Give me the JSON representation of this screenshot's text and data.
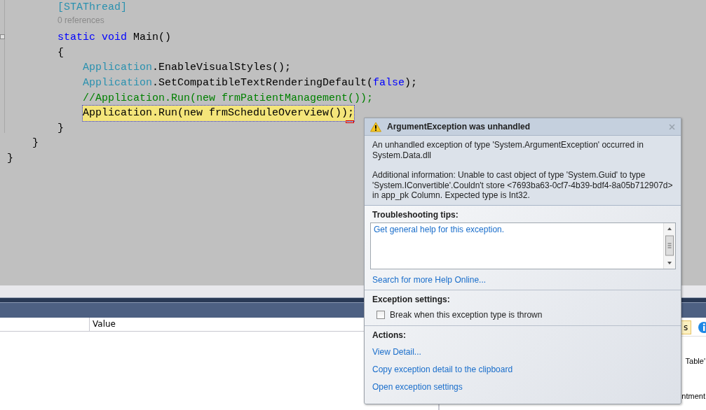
{
  "editor": {
    "lines": [
      {
        "children": [
          {
            "children": [
              {
                "kind": "code",
                "tokens": [
                  {
                    "text": "[STAThread]",
                    "kind": "type"
                  }
                ]
              },
              {
                "kind": "lens",
                "tokens": [
                  {
                    "text": "0 references",
                    "kind": "lens"
                  }
                ]
              },
              {
                "kind": "code",
                "collapsible": true,
                "tokens": [
                  {
                    "text": "static ",
                    "kind": "keyword"
                  },
                  {
                    "text": "void",
                    "kind": "keyword"
                  },
                  {
                    "text": " Main()",
                    "kind": "plain"
                  }
                ]
              },
              {
                "kind": "code",
                "tokens": [
                  {
                    "text": "{",
                    "kind": "plain"
                  }
                ],
                "children": [
                  {
                    "kind": "code",
                    "tokens": [
                      {
                        "text": "Application",
                        "kind": "type"
                      },
                      {
                        "text": ".EnableVisualStyles();",
                        "kind": "plain"
                      }
                    ]
                  },
                  {
                    "kind": "code",
                    "tokens": [
                      {
                        "text": "Application",
                        "kind": "type"
                      },
                      {
                        "text": ".SetCompatibleTextRenderingDefault(",
                        "kind": "plain"
                      },
                      {
                        "text": "false",
                        "kind": "keyword"
                      },
                      {
                        "text": ");",
                        "kind": "plain"
                      }
                    ]
                  },
                  {
                    "kind": "code",
                    "tokens": [
                      {
                        "text": "//Application.Run(new frmPatientManagement());",
                        "kind": "comment"
                      }
                    ]
                  },
                  {
                    "kind": "code",
                    "highlighted": true,
                    "tokens": [
                      {
                        "text": "Application.Run(new frmScheduleOverview());",
                        "kind": "plain"
                      }
                    ]
                  }
                ]
              },
              {
                "kind": "code",
                "tokens": [
                  {
                    "text": "}",
                    "kind": "plain"
                  }
                ]
              }
            ]
          },
          {
            "kind": "code",
            "tokens": [
              {
                "text": "}",
                "kind": "plain"
              }
            ]
          }
        ]
      },
      {
        "kind": "code",
        "tokens": [
          {
            "text": "}",
            "kind": "plain"
          }
        ]
      }
    ]
  },
  "exception_popup": {
    "title": "ArgumentException was unhandled",
    "message": [
      "An unhandled exception of type 'System.ArgumentException' occurred in System.Data.dll",
      "Additional information: Unable to cast object of type 'System.Guid' to type 'System.IConvertible'.Couldn't store <7693ba63-0cf7-4b39-bdf4-8a05b712907d> in app_pk Column.  Expected type is Int32."
    ],
    "troubleshooting": {
      "heading": "Troubleshooting tips:",
      "tips": [
        "Get general help for this exception."
      ],
      "link": "Search for more Help Online..."
    },
    "exception_settings": {
      "heading": "Exception settings:",
      "checkbox": {
        "label": "Break when this exception type is thrown",
        "checked": false
      }
    },
    "actions": {
      "heading": "Actions:",
      "links": [
        "View Detail...",
        "Copy exception detail to the clipboard",
        "Open exception settings"
      ]
    }
  },
  "locals": {
    "columns": [
      "Value"
    ]
  },
  "error_list": {
    "filter_button": "s",
    "messages": [
      "Table'",
      "ntment"
    ]
  }
}
